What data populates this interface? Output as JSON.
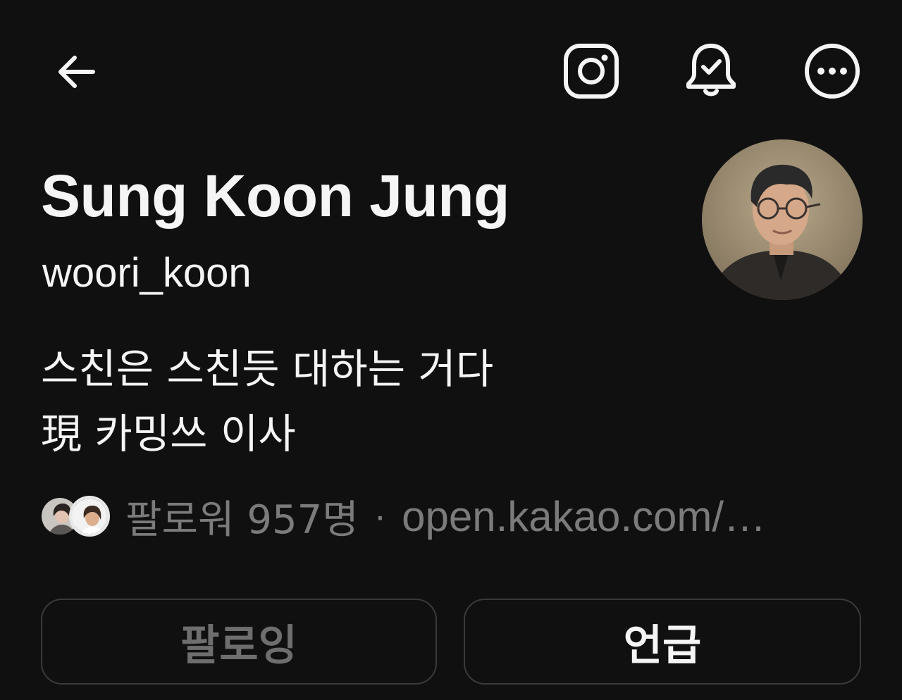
{
  "profile": {
    "display_name": "Sung Koon Jung",
    "username": "woori_koon",
    "bio_lines": [
      "스친은 스친듯 대하는 거다",
      "現 카밍쓰 이사"
    ],
    "followers_text": "팔로워 957명",
    "separator": "·",
    "link_text": "open.kakao.com/…"
  },
  "actions": {
    "following_label": "팔로잉",
    "mention_label": "언급"
  },
  "icons": {
    "back": "arrow-left-icon",
    "instagram": "instagram-icon",
    "notifications": "bell-check-icon",
    "more": "more-horizontal-icon"
  },
  "colors": {
    "background": "#101010",
    "text_primary": "#f5f5f5",
    "text_secondary": "#7b7b7b",
    "button_border": "#3a3a3a"
  }
}
